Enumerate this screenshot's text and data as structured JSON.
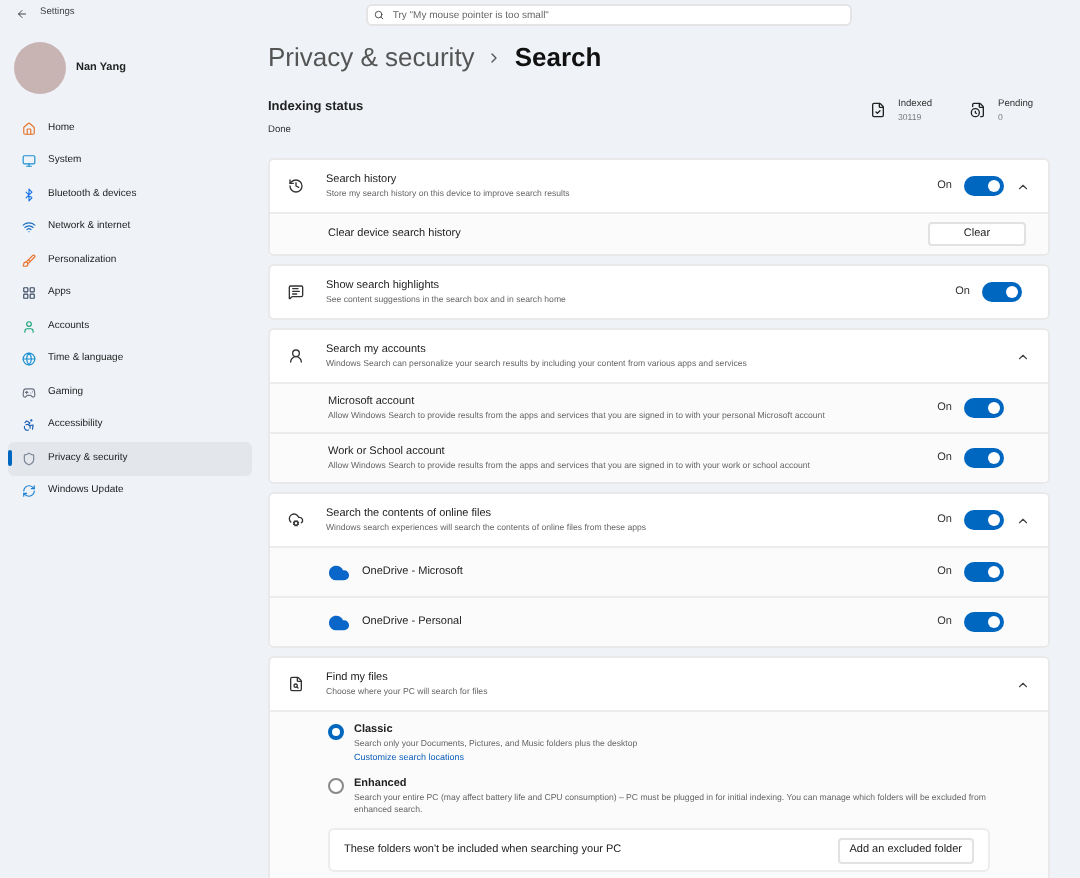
{
  "window": {
    "title": "Settings"
  },
  "search": {
    "placeholder": "Try \"My mouse pointer is too small\""
  },
  "user": {
    "name": "Nan Yang"
  },
  "sidebar": {
    "items": [
      {
        "label": "Home",
        "kind": "home",
        "selected": false
      },
      {
        "label": "System",
        "kind": "system",
        "selected": false
      },
      {
        "label": "Bluetooth & devices",
        "kind": "bluetooth",
        "selected": false
      },
      {
        "label": "Network & internet",
        "kind": "network",
        "selected": false
      },
      {
        "label": "Personalization",
        "kind": "personalization",
        "selected": false
      },
      {
        "label": "Apps",
        "kind": "apps",
        "selected": false
      },
      {
        "label": "Accounts",
        "kind": "accounts",
        "selected": false
      },
      {
        "label": "Time & language",
        "kind": "time",
        "selected": false
      },
      {
        "label": "Gaming",
        "kind": "gaming",
        "selected": false
      },
      {
        "label": "Accessibility",
        "kind": "accessibility",
        "selected": false
      },
      {
        "label": "Privacy & security",
        "kind": "privacy",
        "selected": true
      },
      {
        "label": "Windows Update",
        "kind": "update",
        "selected": false
      }
    ]
  },
  "breadcrumb": {
    "parent": "Privacy & security",
    "current": "Search"
  },
  "indexing": {
    "title": "Indexing status",
    "status": "Done",
    "stats": [
      {
        "label": "Indexed",
        "value": "30119"
      },
      {
        "label": "Pending",
        "value": "0"
      }
    ]
  },
  "sections": [
    {
      "title": "Search history",
      "description": "Store my search history on this device to improve search results",
      "toggle_label": "On",
      "on": true,
      "expanded": true,
      "rows": [
        {
          "kind": "button",
          "label": "Clear device search history",
          "button": "Clear"
        }
      ]
    },
    {
      "title": "Show search highlights",
      "description": "See content suggestions in the search box and in search home",
      "toggle_label": "On",
      "on": true
    },
    {
      "title": "Search my accounts",
      "description": "Windows Search can personalize your search results by including your content from various apps and services",
      "expanded": true,
      "rows": [
        {
          "kind": "toggle",
          "title": "Microsoft account",
          "description": "Allow Windows Search to provide results from the apps and services that you are signed in to with your personal Microsoft account",
          "toggle_label": "On",
          "on": true
        },
        {
          "kind": "toggle",
          "title": "Work or School account",
          "description": "Allow Windows Search to provide results from the apps and services that you are signed in to with your work or school account",
          "toggle_label": "On",
          "on": true
        }
      ]
    },
    {
      "title": "Search the contents of online files",
      "description": "Windows search experiences will search the contents of online files from these apps",
      "toggle_label": "On",
      "on": true,
      "expanded": true,
      "rows": [
        {
          "kind": "cloud",
          "title": "OneDrive - Microsoft",
          "toggle_label": "On",
          "on": true
        },
        {
          "kind": "cloud",
          "title": "OneDrive - Personal",
          "toggle_label": "On",
          "on": true
        }
      ]
    },
    {
      "title": "Find my files",
      "description": "Choose where your PC will search for files",
      "expanded": true,
      "rows": [
        {
          "kind": "radio",
          "title": "Classic",
          "description": "Search only your Documents, Pictures, and Music folders plus the desktop",
          "link": "Customize search locations",
          "selected": true
        },
        {
          "kind": "radio",
          "title": "Enhanced",
          "description": "Search your entire PC (may affect battery life and CPU consumption) – PC must be plugged in for initial indexing. You can manage which folders will be excluded from enhanced search.",
          "selected": false
        },
        {
          "kind": "panel",
          "label": "These folders won't be included when searching your PC",
          "button": "Add an excluded folder"
        }
      ]
    }
  ]
}
